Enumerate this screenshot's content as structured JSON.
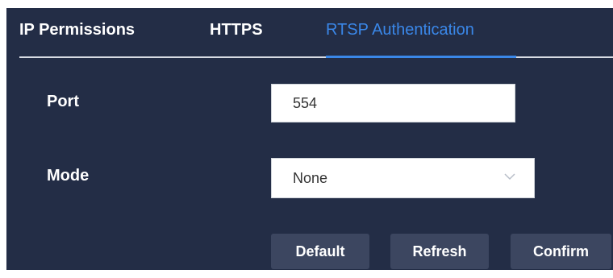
{
  "tabs": {
    "ip_permissions": "IP Permissions",
    "https": "HTTPS",
    "rtsp_authentication": "RTSP Authentication",
    "active": "RTSP Authentication"
  },
  "form": {
    "port_label": "Port",
    "port_value": "554",
    "mode_label": "Mode",
    "mode_value": "None"
  },
  "buttons": {
    "default": "Default",
    "refresh": "Refresh",
    "confirm": "Confirm"
  },
  "colors": {
    "panel_background": "#232d46",
    "accent": "#3a87e8",
    "button_background": "#3c4660"
  },
  "icons": {
    "mode_dropdown": "chevron-down-icon"
  }
}
